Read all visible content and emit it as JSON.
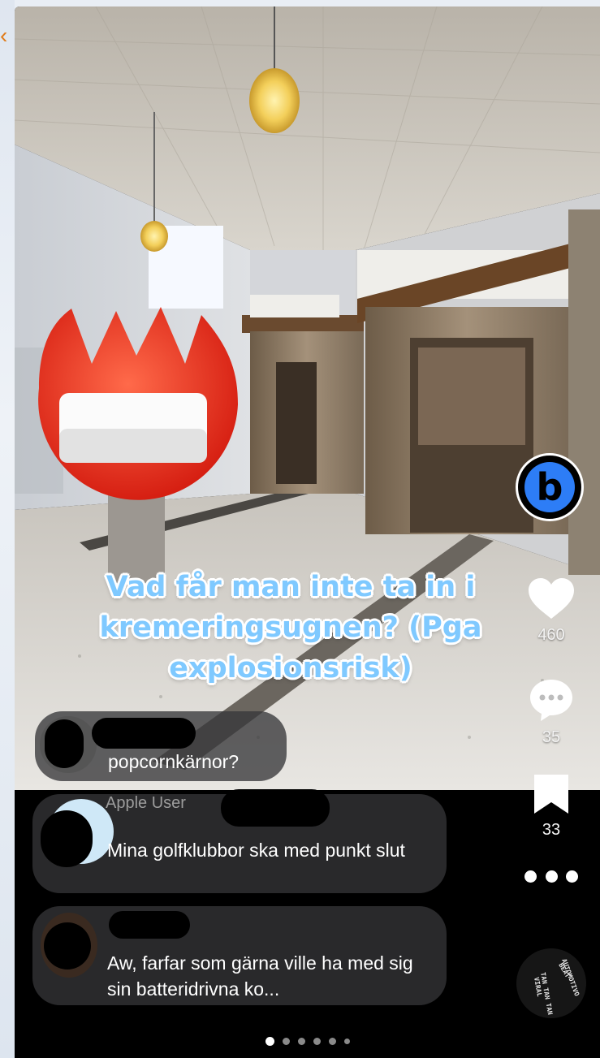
{
  "caption": "Vad får man inte ta in i kremeringsugnen? (Pga explosionsrisk)",
  "actions": {
    "likes": "460",
    "comments": "35",
    "saves": "33"
  },
  "comments": [
    {
      "text": "popcornkärnor?"
    },
    {
      "author_partial": "Apple User",
      "text": "Mina golfklubbor ska med punkt slut"
    },
    {
      "text": "Aw, farfar som gärna ville ha med sig sin batteridrivna ko..."
    }
  ],
  "sound_label": "BEAT AUTOMOTIVO TAN TAN TAN VIRAL",
  "pagination": {
    "total": 6,
    "active": 1
  },
  "colors": {
    "caption": "#7fc9ff",
    "profile_accent": "#2d7df6",
    "back": "#e07b1a"
  }
}
